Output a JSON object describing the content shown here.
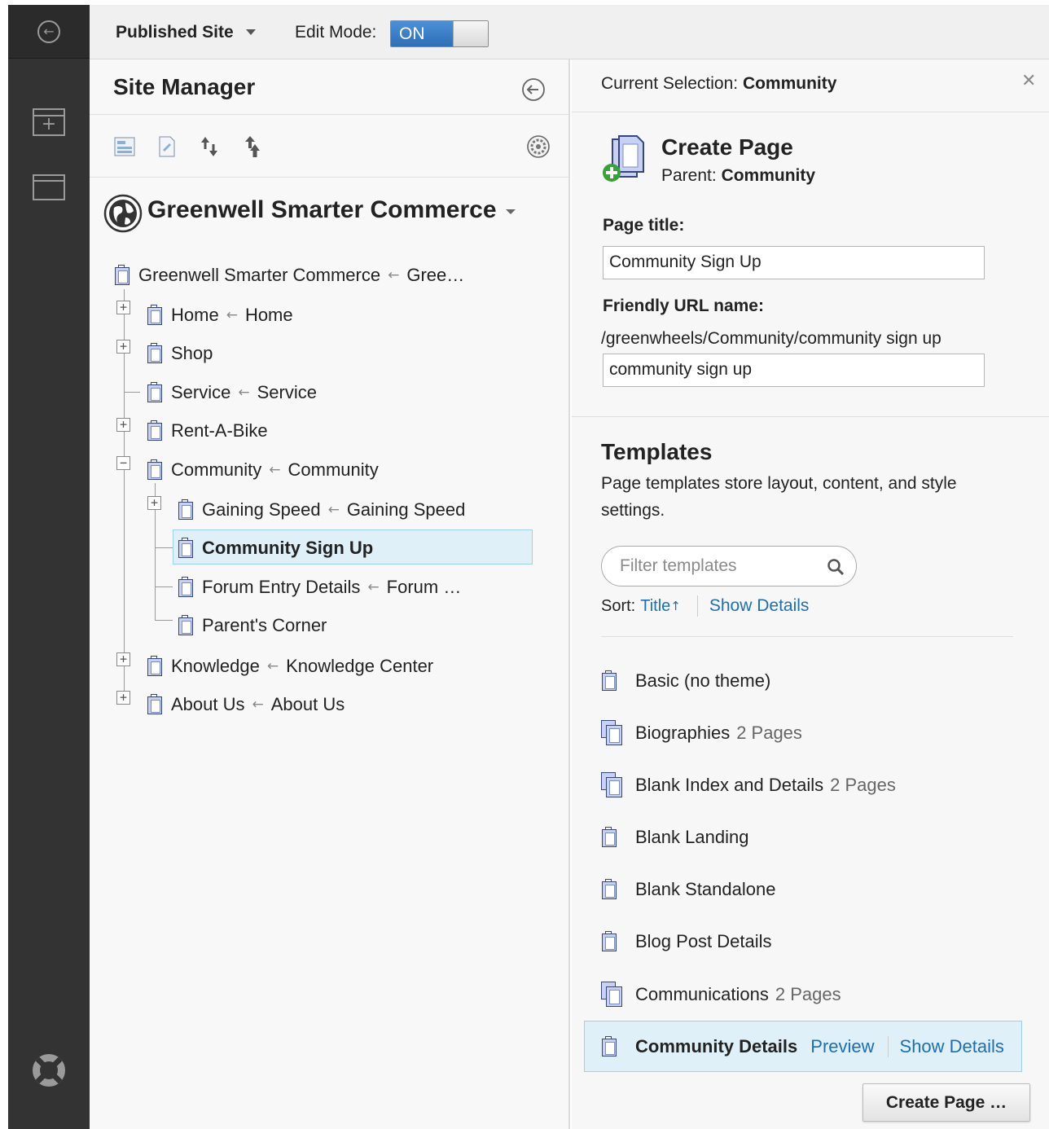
{
  "topbar": {
    "published_site": "Published Site",
    "edit_mode_label": "Edit Mode:",
    "edit_mode_value": "ON"
  },
  "site_manager": {
    "title": "Site Manager",
    "site_name": "Greenwell Smarter Commerce",
    "tree": [
      {
        "label": "Greenwell Smarter Commerce",
        "target": "Gree…"
      },
      {
        "label": "Home",
        "target": "Home"
      },
      {
        "label": "Shop",
        "target": ""
      },
      {
        "label": "Service",
        "target": "Service"
      },
      {
        "label": "Rent-A-Bike",
        "target": ""
      },
      {
        "label": "Community",
        "target": "Community"
      },
      {
        "label": "Gaining Speed",
        "target": "Gaining Speed"
      },
      {
        "label": "Community Sign Up",
        "target": ""
      },
      {
        "label": "Forum Entry Details",
        "target": "Forum …"
      },
      {
        "label": "Parent's Corner",
        "target": ""
      },
      {
        "label": "Knowledge",
        "target": "Knowledge Center"
      },
      {
        "label": "About Us",
        "target": "About Us"
      }
    ]
  },
  "panel": {
    "current_selection_label": "Current Selection:",
    "current_selection_value": "Community",
    "create_title": "Create Page",
    "parent_label": "Parent:",
    "parent_value": "Community",
    "page_title_label": "Page title:",
    "page_title_value": "Community Sign Up",
    "friendly_url_label": "Friendly URL name:",
    "friendly_url_path": "/greenwheels/Community/community sign up",
    "friendly_url_value": "community sign up",
    "templates_title": "Templates",
    "templates_desc": "Page templates store layout, content, and style settings.",
    "filter_placeholder": "Filter templates",
    "sort_label": "Sort:",
    "sort_value": "Title",
    "show_details": "Show Details",
    "templates": [
      {
        "name": "Basic (no theme)",
        "count": ""
      },
      {
        "name": "Biographies",
        "count": "2 Pages"
      },
      {
        "name": "Blank Index and Details",
        "count": "2 Pages"
      },
      {
        "name": "Blank Landing",
        "count": ""
      },
      {
        "name": "Blank Standalone",
        "count": ""
      },
      {
        "name": "Blog Post Details",
        "count": ""
      },
      {
        "name": "Communications",
        "count": "2 Pages"
      },
      {
        "name": "Community Details",
        "count": ""
      }
    ],
    "selected_preview": "Preview",
    "selected_show_details": "Show Details",
    "create_button": "Create Page …"
  },
  "colors": {
    "accent": "#1c6fb7",
    "toggle_on": "#3b80c8",
    "selection_bg": "#dff0f8",
    "rail": "#333333"
  }
}
